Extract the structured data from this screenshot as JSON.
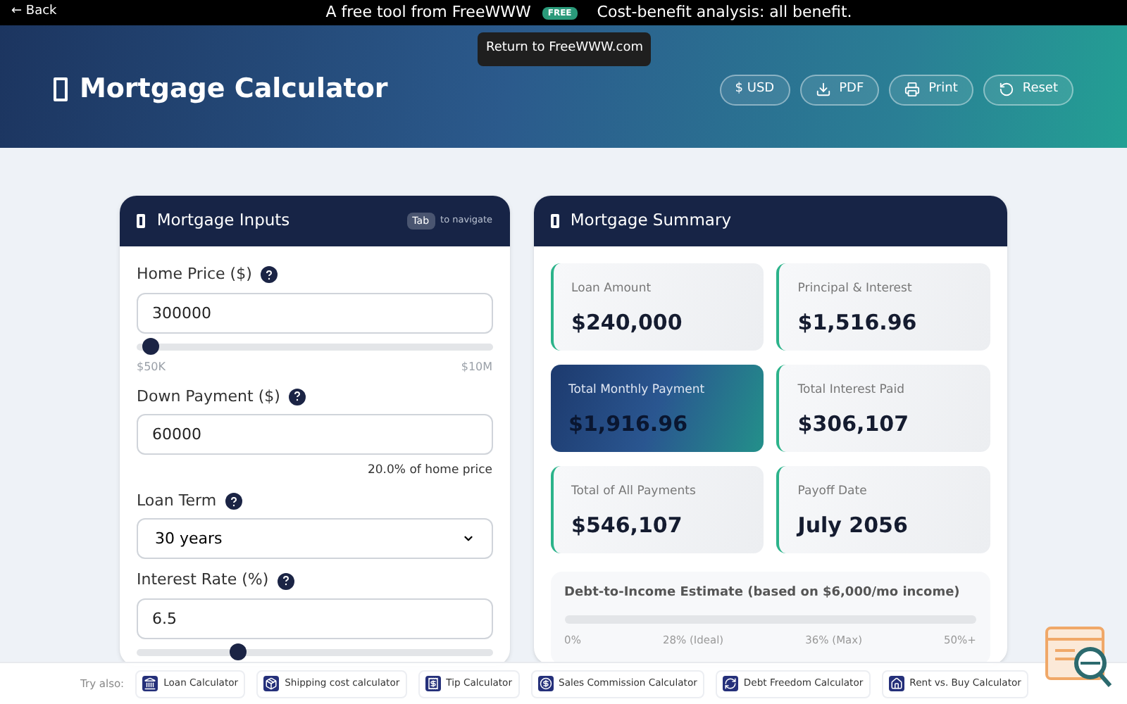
{
  "top_bar": {
    "back": "← Back",
    "tagline": "A free tool from FreeWWW",
    "badge": "FREE",
    "slogan": "Cost-benefit analysis: all benefit.",
    "tooltip": "Return to FreeWWW.com"
  },
  "header": {
    "title": "Mortgage Calculator",
    "buttons": [
      {
        "kind": "currency",
        "label": "$ USD"
      },
      {
        "kind": "download",
        "label": "PDF"
      },
      {
        "kind": "print",
        "label": "Print"
      },
      {
        "kind": "reset",
        "label": "Reset"
      }
    ]
  },
  "inputs": {
    "title": "Mortgage Inputs",
    "key": "Tab",
    "key_hint": "to navigate",
    "fields": [
      {
        "kind": "number",
        "label": "Home Price ($)",
        "value": "300000",
        "slider": {
          "level": 0.025,
          "min": "$50K",
          "max": "$10M"
        }
      },
      {
        "kind": "number",
        "label": "Down Payment ($)",
        "value": "60000",
        "note": "20.0% of home price"
      },
      {
        "kind": "select",
        "label": "Loan Term",
        "value": "30 years"
      },
      {
        "kind": "number",
        "label": "Interest Rate (%)",
        "value": "6.5",
        "slider": {
          "level": 0.27
        }
      }
    ]
  },
  "summary": {
    "title": "Mortgage Summary",
    "tiles": [
      {
        "label": "Loan Amount",
        "value": "$240,000",
        "selected": false
      },
      {
        "label": "Principal & Interest",
        "value": "$1,516.96",
        "selected": false
      },
      {
        "label": "Total Monthly Payment",
        "value": "$1,916.96",
        "selected": true
      },
      {
        "label": "Total Interest Paid",
        "value": "$306,107",
        "selected": false
      },
      {
        "label": "Total of All Payments",
        "value": "$546,107",
        "selected": false
      },
      {
        "label": "Payoff Date",
        "value": "July 2056",
        "selected": false
      }
    ],
    "dti": {
      "title": "Debt-to-Income Estimate (based on $6,000/mo income)",
      "ticks": [
        "0%",
        "28% (Ideal)",
        "36% (Max)",
        "50%+"
      ]
    }
  },
  "footer": {
    "label": "Try also:",
    "links": [
      {
        "kind": "bank",
        "label": "Loan Calculator"
      },
      {
        "kind": "box",
        "label": "Shipping cost calculator"
      },
      {
        "kind": "receipt",
        "label": "Tip Calculator"
      },
      {
        "kind": "coin",
        "label": "Sales Commission Calculator"
      },
      {
        "kind": "cycle",
        "label": "Debt Freedom Calculator"
      },
      {
        "kind": "home",
        "label": "Rent vs. Buy Calculator"
      }
    ]
  }
}
